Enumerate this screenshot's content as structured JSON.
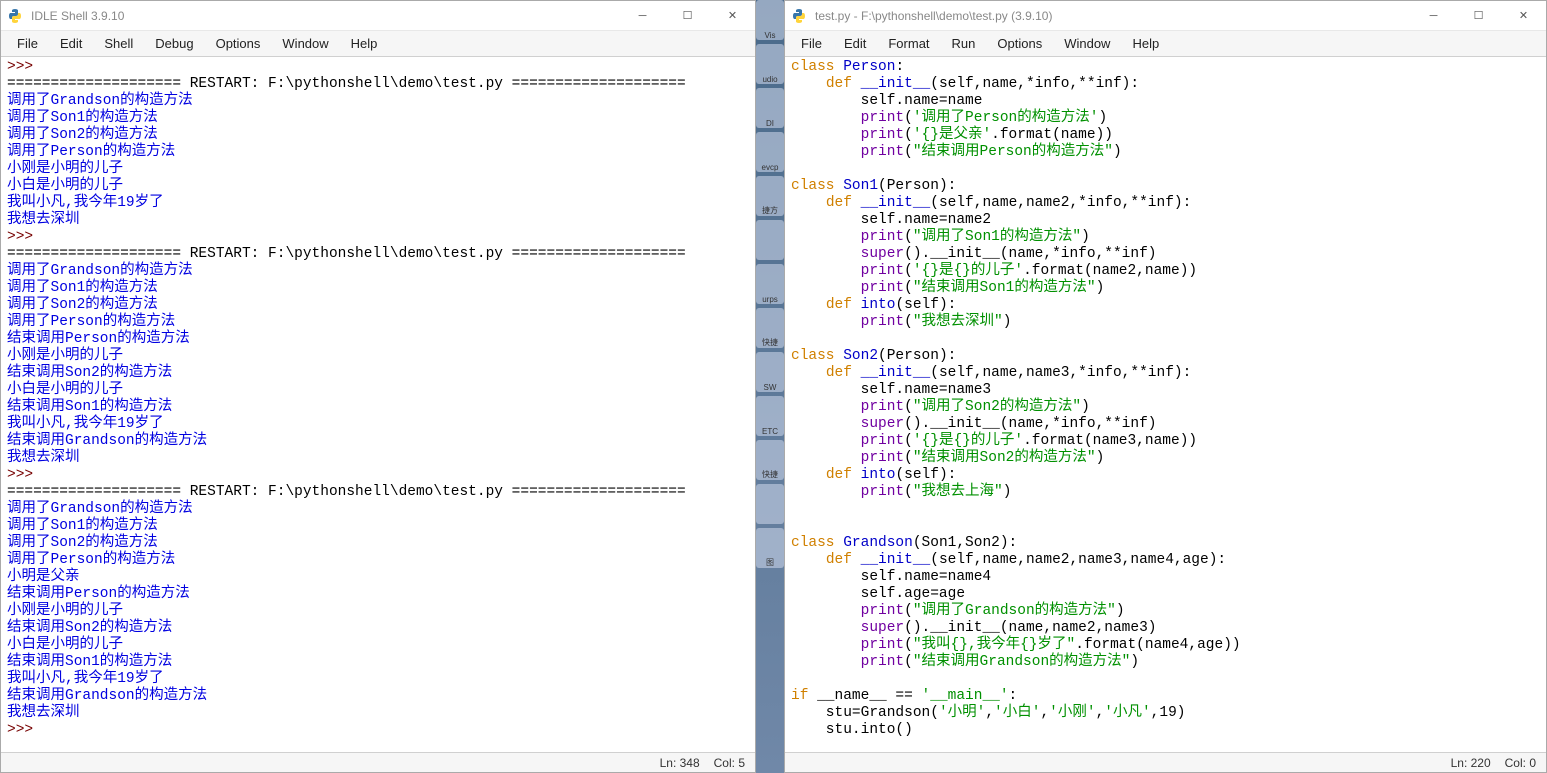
{
  "shell_window": {
    "title": "IDLE Shell 3.9.10",
    "menus": [
      "File",
      "Edit",
      "Shell",
      "Debug",
      "Options",
      "Window",
      "Help"
    ],
    "status_ln": "Ln: 348",
    "status_col": "Col: 5",
    "content": [
      {
        "type": "prompt",
        "text": ">>>"
      },
      {
        "type": "banner",
        "text": "==================== RESTART: F:\\pythonshell\\demo\\test.py ===================="
      },
      {
        "type": "output",
        "text": "调用了Grandson的构造方法"
      },
      {
        "type": "output",
        "text": "调用了Son1的构造方法"
      },
      {
        "type": "output",
        "text": "调用了Son2的构造方法"
      },
      {
        "type": "output",
        "text": "调用了Person的构造方法"
      },
      {
        "type": "output",
        "text": "小刚是小明的儿子"
      },
      {
        "type": "output",
        "text": "小白是小明的儿子"
      },
      {
        "type": "output",
        "text": "我叫小凡,我今年19岁了"
      },
      {
        "type": "output",
        "text": "我想去深圳"
      },
      {
        "type": "prompt",
        "text": ">>>"
      },
      {
        "type": "banner",
        "text": "==================== RESTART: F:\\pythonshell\\demo\\test.py ===================="
      },
      {
        "type": "output",
        "text": "调用了Grandson的构造方法"
      },
      {
        "type": "output",
        "text": "调用了Son1的构造方法"
      },
      {
        "type": "output",
        "text": "调用了Son2的构造方法"
      },
      {
        "type": "output",
        "text": "调用了Person的构造方法"
      },
      {
        "type": "output",
        "text": "结束调用Person的构造方法"
      },
      {
        "type": "output",
        "text": "小刚是小明的儿子"
      },
      {
        "type": "output",
        "text": "结束调用Son2的构造方法"
      },
      {
        "type": "output",
        "text": "小白是小明的儿子"
      },
      {
        "type": "output",
        "text": "结束调用Son1的构造方法"
      },
      {
        "type": "output",
        "text": "我叫小凡,我今年19岁了"
      },
      {
        "type": "output",
        "text": "结束调用Grandson的构造方法"
      },
      {
        "type": "output",
        "text": "我想去深圳"
      },
      {
        "type": "prompt",
        "text": ">>>"
      },
      {
        "type": "banner",
        "text": "==================== RESTART: F:\\pythonshell\\demo\\test.py ===================="
      },
      {
        "type": "output",
        "text": "调用了Grandson的构造方法"
      },
      {
        "type": "output",
        "text": "调用了Son1的构造方法"
      },
      {
        "type": "output",
        "text": "调用了Son2的构造方法"
      },
      {
        "type": "output",
        "text": "调用了Person的构造方法"
      },
      {
        "type": "output",
        "text": "小明是父亲"
      },
      {
        "type": "output",
        "text": "结束调用Person的构造方法"
      },
      {
        "type": "output",
        "text": "小刚是小明的儿子"
      },
      {
        "type": "output",
        "text": "结束调用Son2的构造方法"
      },
      {
        "type": "output",
        "text": "小白是小明的儿子"
      },
      {
        "type": "output",
        "text": "结束调用Son1的构造方法"
      },
      {
        "type": "output",
        "text": "我叫小凡,我今年19岁了"
      },
      {
        "type": "output",
        "text": "结束调用Grandson的构造方法"
      },
      {
        "type": "output",
        "text": "我想去深圳"
      },
      {
        "type": "prompt",
        "text": ">>>"
      }
    ]
  },
  "editor_window": {
    "title": "test.py - F:\\pythonshell\\demo\\test.py (3.9.10)",
    "menus": [
      "File",
      "Edit",
      "Format",
      "Run",
      "Options",
      "Window",
      "Help"
    ],
    "status_ln": "Ln: 220",
    "status_col": "Col: 0",
    "code": [
      [
        {
          "c": "kw",
          "t": "class "
        },
        {
          "c": "cls",
          "t": "Person"
        },
        {
          "c": "plain",
          "t": ":"
        }
      ],
      [
        {
          "c": "plain",
          "t": "    "
        },
        {
          "c": "kw",
          "t": "def "
        },
        {
          "c": "fn",
          "t": "__init__"
        },
        {
          "c": "plain",
          "t": "(self,name,*info,**inf):"
        }
      ],
      [
        {
          "c": "plain",
          "t": "        self.name=name"
        }
      ],
      [
        {
          "c": "plain",
          "t": "        "
        },
        {
          "c": "builtin",
          "t": "print"
        },
        {
          "c": "plain",
          "t": "("
        },
        {
          "c": "str",
          "t": "'调用了Person的构造方法'"
        },
        {
          "c": "plain",
          "t": ")"
        }
      ],
      [
        {
          "c": "plain",
          "t": "        "
        },
        {
          "c": "builtin",
          "t": "print"
        },
        {
          "c": "plain",
          "t": "("
        },
        {
          "c": "str",
          "t": "'{}是父亲'"
        },
        {
          "c": "plain",
          "t": ".format(name))"
        }
      ],
      [
        {
          "c": "plain",
          "t": "        "
        },
        {
          "c": "builtin",
          "t": "print"
        },
        {
          "c": "plain",
          "t": "("
        },
        {
          "c": "str",
          "t": "\"结束调用Person的构造方法\""
        },
        {
          "c": "plain",
          "t": ")"
        }
      ],
      [],
      [
        {
          "c": "kw",
          "t": "class "
        },
        {
          "c": "cls",
          "t": "Son1"
        },
        {
          "c": "plain",
          "t": "(Person):"
        }
      ],
      [
        {
          "c": "plain",
          "t": "    "
        },
        {
          "c": "kw",
          "t": "def "
        },
        {
          "c": "fn",
          "t": "__init__"
        },
        {
          "c": "plain",
          "t": "(self,name,name2,*info,**inf):"
        }
      ],
      [
        {
          "c": "plain",
          "t": "        self.name=name2"
        }
      ],
      [
        {
          "c": "plain",
          "t": "        "
        },
        {
          "c": "builtin",
          "t": "print"
        },
        {
          "c": "plain",
          "t": "("
        },
        {
          "c": "str",
          "t": "\"调用了Son1的构造方法\""
        },
        {
          "c": "plain",
          "t": ")"
        }
      ],
      [
        {
          "c": "plain",
          "t": "        "
        },
        {
          "c": "builtin",
          "t": "super"
        },
        {
          "c": "plain",
          "t": "().__init__(name,*info,**inf)"
        }
      ],
      [
        {
          "c": "plain",
          "t": "        "
        },
        {
          "c": "builtin",
          "t": "print"
        },
        {
          "c": "plain",
          "t": "("
        },
        {
          "c": "str",
          "t": "'{}是{}的儿子'"
        },
        {
          "c": "plain",
          "t": ".format(name2,name))"
        }
      ],
      [
        {
          "c": "plain",
          "t": "        "
        },
        {
          "c": "builtin",
          "t": "print"
        },
        {
          "c": "plain",
          "t": "("
        },
        {
          "c": "str",
          "t": "\"结束调用Son1的构造方法\""
        },
        {
          "c": "plain",
          "t": ")"
        }
      ],
      [
        {
          "c": "plain",
          "t": "    "
        },
        {
          "c": "kw",
          "t": "def "
        },
        {
          "c": "fn",
          "t": "into"
        },
        {
          "c": "plain",
          "t": "(self):"
        }
      ],
      [
        {
          "c": "plain",
          "t": "        "
        },
        {
          "c": "builtin",
          "t": "print"
        },
        {
          "c": "plain",
          "t": "("
        },
        {
          "c": "str",
          "t": "\"我想去深圳\""
        },
        {
          "c": "plain",
          "t": ")"
        }
      ],
      [],
      [
        {
          "c": "kw",
          "t": "class "
        },
        {
          "c": "cls",
          "t": "Son2"
        },
        {
          "c": "plain",
          "t": "(Person):"
        }
      ],
      [
        {
          "c": "plain",
          "t": "    "
        },
        {
          "c": "kw",
          "t": "def "
        },
        {
          "c": "fn",
          "t": "__init__"
        },
        {
          "c": "plain",
          "t": "(self,name,name3,*info,**inf):"
        }
      ],
      [
        {
          "c": "plain",
          "t": "        self.name=name3"
        }
      ],
      [
        {
          "c": "plain",
          "t": "        "
        },
        {
          "c": "builtin",
          "t": "print"
        },
        {
          "c": "plain",
          "t": "("
        },
        {
          "c": "str",
          "t": "\"调用了Son2的构造方法\""
        },
        {
          "c": "plain",
          "t": ")"
        }
      ],
      [
        {
          "c": "plain",
          "t": "        "
        },
        {
          "c": "builtin",
          "t": "super"
        },
        {
          "c": "plain",
          "t": "().__init__(name,*info,**inf)"
        }
      ],
      [
        {
          "c": "plain",
          "t": "        "
        },
        {
          "c": "builtin",
          "t": "print"
        },
        {
          "c": "plain",
          "t": "("
        },
        {
          "c": "str",
          "t": "'{}是{}的儿子'"
        },
        {
          "c": "plain",
          "t": ".format(name3,name))"
        }
      ],
      [
        {
          "c": "plain",
          "t": "        "
        },
        {
          "c": "builtin",
          "t": "print"
        },
        {
          "c": "plain",
          "t": "("
        },
        {
          "c": "str",
          "t": "\"结束调用Son2的构造方法\""
        },
        {
          "c": "plain",
          "t": ")"
        }
      ],
      [
        {
          "c": "plain",
          "t": "    "
        },
        {
          "c": "kw",
          "t": "def "
        },
        {
          "c": "fn",
          "t": "into"
        },
        {
          "c": "plain",
          "t": "(self):"
        }
      ],
      [
        {
          "c": "plain",
          "t": "        "
        },
        {
          "c": "builtin",
          "t": "print"
        },
        {
          "c": "plain",
          "t": "("
        },
        {
          "c": "str",
          "t": "\"我想去上海\""
        },
        {
          "c": "plain",
          "t": ")"
        }
      ],
      [],
      [],
      [
        {
          "c": "kw",
          "t": "class "
        },
        {
          "c": "cls",
          "t": "Grandson"
        },
        {
          "c": "plain",
          "t": "(Son1,Son2):"
        }
      ],
      [
        {
          "c": "plain",
          "t": "    "
        },
        {
          "c": "kw",
          "t": "def "
        },
        {
          "c": "fn",
          "t": "__init__"
        },
        {
          "c": "plain",
          "t": "(self,name,name2,name3,name4,age):"
        }
      ],
      [
        {
          "c": "plain",
          "t": "        self.name=name4"
        }
      ],
      [
        {
          "c": "plain",
          "t": "        self.age=age"
        }
      ],
      [
        {
          "c": "plain",
          "t": "        "
        },
        {
          "c": "builtin",
          "t": "print"
        },
        {
          "c": "plain",
          "t": "("
        },
        {
          "c": "str",
          "t": "\"调用了Grandson的构造方法\""
        },
        {
          "c": "plain",
          "t": ")"
        }
      ],
      [
        {
          "c": "plain",
          "t": "        "
        },
        {
          "c": "builtin",
          "t": "super"
        },
        {
          "c": "plain",
          "t": "().__init__(name,name2,name3)"
        }
      ],
      [
        {
          "c": "plain",
          "t": "        "
        },
        {
          "c": "builtin",
          "t": "print"
        },
        {
          "c": "plain",
          "t": "("
        },
        {
          "c": "str",
          "t": "\"我叫{},我今年{}岁了\""
        },
        {
          "c": "plain",
          "t": ".format(name4,age))"
        }
      ],
      [
        {
          "c": "plain",
          "t": "        "
        },
        {
          "c": "builtin",
          "t": "print"
        },
        {
          "c": "plain",
          "t": "("
        },
        {
          "c": "str",
          "t": "\"结束调用Grandson的构造方法\""
        },
        {
          "c": "plain",
          "t": ")"
        }
      ],
      [],
      [
        {
          "c": "kw",
          "t": "if "
        },
        {
          "c": "plain",
          "t": "__name__ == "
        },
        {
          "c": "str",
          "t": "'__main__'"
        },
        {
          "c": "plain",
          "t": ":"
        }
      ],
      [
        {
          "c": "plain",
          "t": "    stu=Grandson("
        },
        {
          "c": "str",
          "t": "'小明'"
        },
        {
          "c": "plain",
          "t": ","
        },
        {
          "c": "str",
          "t": "'小白'"
        },
        {
          "c": "plain",
          "t": ","
        },
        {
          "c": "str",
          "t": "'小刚'"
        },
        {
          "c": "plain",
          "t": ","
        },
        {
          "c": "str",
          "t": "'小凡'"
        },
        {
          "c": "plain",
          "t": ",19)"
        }
      ],
      [
        {
          "c": "plain",
          "t": "    stu.into()"
        }
      ]
    ]
  },
  "gap_labels": [
    "Vis",
    "udio",
    "DI",
    "evcp",
    "捷方",
    "",
    "urps",
    "快捷",
    "SW",
    "ETC",
    "快捷",
    "",
    "图"
  ]
}
